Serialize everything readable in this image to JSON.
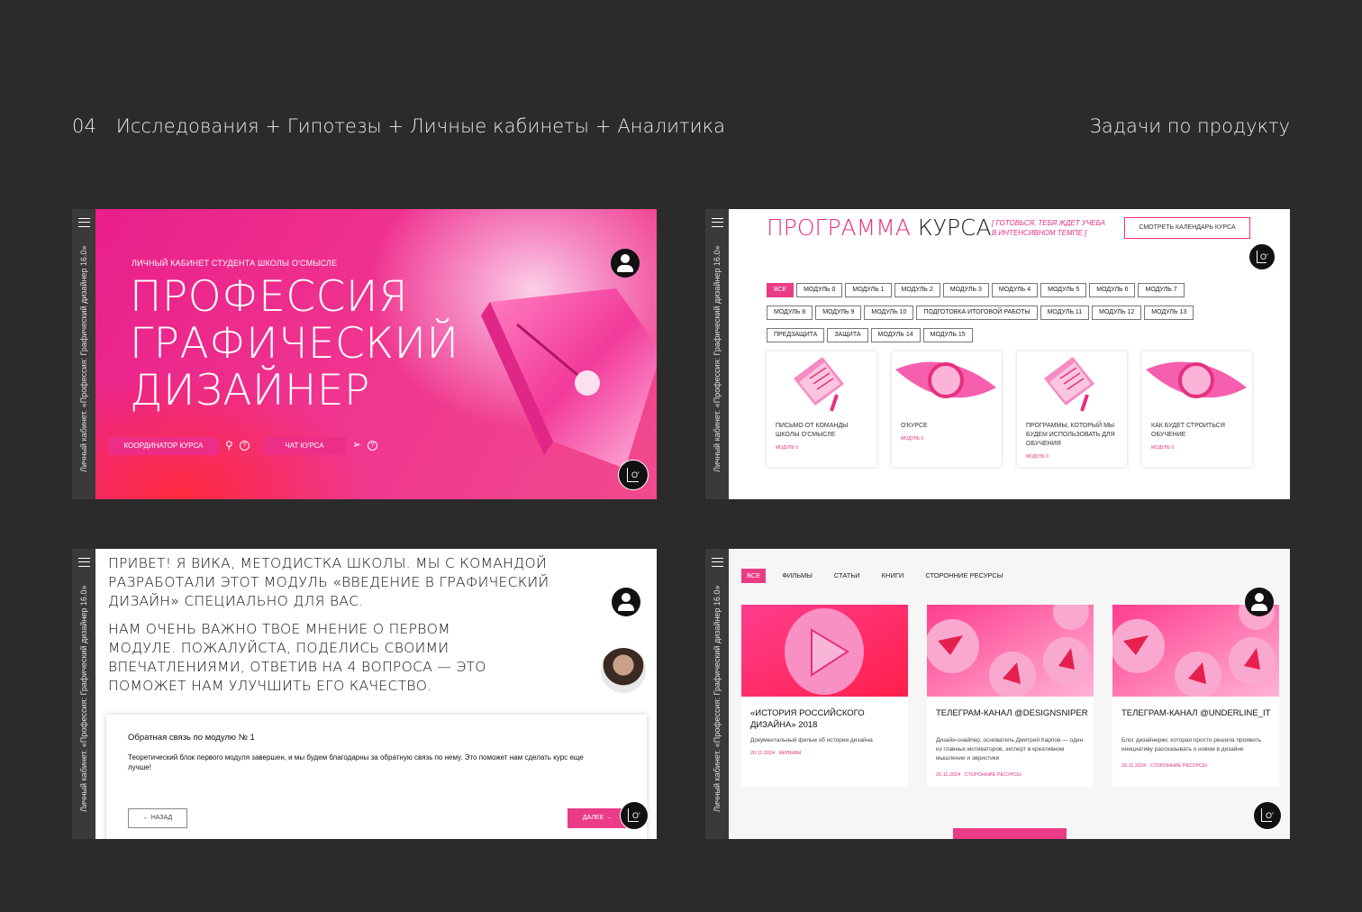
{
  "header": {
    "number": "04",
    "title": "Исследования + Гипотезы + Личные кабинеты + Аналитика",
    "right": "Задачи по продукту"
  },
  "sidebar": {
    "vertical_text": "Личный кабинет. «Профессия: Графический дизайнер 16.0»"
  },
  "panel1": {
    "subtitle": "ЛИЧНЫЙ КАБИНЕТ СТУДЕНТА ШКОЛЫ О'СМЫСЛЕ",
    "title_line1": "ПРОФЕССИЯ",
    "title_line2": "ГРАФИЧЕСКИЙ",
    "title_line3": "ДИЗАЙНЕР",
    "btn_coordinator": "КООРДИНАТОР КУРСА",
    "btn_chat": "ЧАТ КУРСА",
    "help": "?"
  },
  "panel2": {
    "title_a": "ПРОГРАММА",
    "title_b": "КУРСА",
    "note_line1": "[ ГОТОВЬСЯ, ТЕБЯ ЖДЕТ УЧЕБА",
    "note_line2": "В ИНТЕНСИВНОМ ТЕМПЕ ]",
    "calendar_btn": "СМОТРЕТЬ КАЛЕНДАРЬ КУРСА",
    "chips": [
      "ВСЕ",
      "МОДУЛЬ 0",
      "МОДУЛЬ 1",
      "МОДУЛЬ 2",
      "МОДУЛЬ 3",
      "МОДУЛЬ 4",
      "МОДУЛЬ 5",
      "МОДУЛЬ 6",
      "МОДУЛЬ 7",
      "МОДУЛЬ 8",
      "МОДУЛЬ 9",
      "МОДУЛЬ 10",
      "ПОДГОТОВКА ИТОГОВОЙ РАБОТЫ",
      "МОДУЛЬ 11",
      "МОДУЛЬ 12",
      "МОДУЛЬ 13",
      "ПРЕДЗАЩИТА",
      "ЗАЩИТА",
      "МОДУЛЬ 14",
      "МОДУЛЬ 15"
    ],
    "cards": [
      {
        "title": "ПИСЬМО ОТ КОМАНДЫ ШКОЛЫ О'СМЫСЛЕ",
        "module": "МОДУЛЬ 0"
      },
      {
        "title": "О'КУРСЕ",
        "module": "МОДУЛЬ 0"
      },
      {
        "title": "ПРОГРАММЫ, КОТОРЫЙ МЫ БУДЕМ ИСПОЛЬЗОВАТЬ ДЛЯ ОБУЧЕНИЯ",
        "module": "МОДУЛЬ 0"
      },
      {
        "title": "КАК БУДЕТ СТРОИТЬСЯ ОБУЧЕНИЕ",
        "module": "МОДУЛЬ 0"
      }
    ]
  },
  "panel3": {
    "greeting": "ПРИВЕТ! Я ВИКА, МЕТОДИСТКА ШКОЛЫ. МЫ С КОМАНДОЙ РАЗРАБОТАЛИ ЭТОТ МОДУЛЬ «ВВЕДЕНИЕ В ГРАФИЧЕСКИЙ ДИЗАЙН» СПЕЦИАЛЬНО ДЛЯ ВАС.",
    "request": "НАМ ОЧЕНЬ ВАЖНО ТВОЕ МНЕНИЕ О ПЕРВОМ МОДУЛЕ. ПОЖАЛУЙСТА, ПОДЕЛИСЬ СВОИМИ ВПЕЧАТЛЕНИЯМИ, ОТВЕТИВ НА 4 ВОПРОСА — ЭТО ПОМОЖЕТ НАМ УЛУЧШИТЬ ЕГО КАЧЕСТВО.",
    "form_title": "Обратная связь по модулю № 1",
    "form_text": "Теоретический блок первого модуля завершен, и мы будем благодарны за обратную связь по нему. Это поможет нам сделать курс еще лучше!",
    "back": "← НАЗАД",
    "next": "ДАЛЕЕ →"
  },
  "panel4": {
    "tabs": [
      "ВСЕ",
      "ФИЛЬМЫ",
      "СТАТЬИ",
      "КНИГИ",
      "СТОРОННИЕ РЕСУРСЫ"
    ],
    "cards": [
      {
        "title": "«ИСТОРИЯ РОССИЙСКОГО ДИЗАЙНА» 2018",
        "desc": "Документальный фильм об истории дизайна",
        "date": "20.11.2024",
        "cat": "ФИЛЬМЫ"
      },
      {
        "title": "ТЕЛЕГРАМ-КАНАЛ @DESIGNSNIPER",
        "desc": "Дизайн-снайпер, основатель Дмитрий Карпов — один из главных мотиваторов, эксперт в креативном мышлении и эвристики",
        "date": "20.11.2024",
        "cat": "СТОРОННИЕ РЕСУРСЫ"
      },
      {
        "title": "ТЕЛЕГРАМ-КАНАЛ @UNDERLINE_IT",
        "desc": "Блог дизайнерки, которая просто решила проявить инициативу рассказывать о новом в дизайне",
        "date": "20.11.2024",
        "cat": "СТОРОННИЕ РЕСУРСЫ"
      }
    ]
  },
  "badge_label": "O'",
  "colors": {
    "accent": "#ea3b86",
    "bg": "#2b2b2b",
    "sidebar": "#3a3a3a"
  }
}
